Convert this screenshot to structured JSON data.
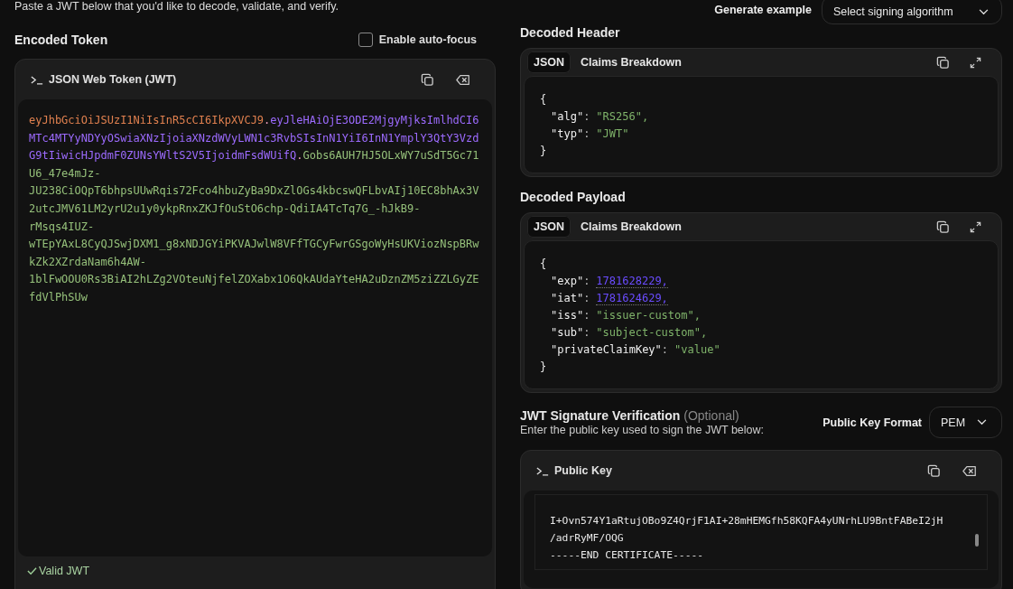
{
  "intro": "Paste a JWT below that you'd like to decode, validate, and verify.",
  "generate": {
    "label": "Generate example",
    "select_placeholder": "Select signing algorithm"
  },
  "encoded": {
    "title": "Encoded Token",
    "autofocus": {
      "label": "Enable auto-focus",
      "checked": false
    },
    "editor_title": "JSON Web Token (JWT)",
    "segments": [
      {
        "text": "eyJhbGciOiJSUzI1NiIsInR5cCI6IkpXVCJ9",
        "color": "#e0804f"
      },
      {
        "text": ".",
        "kind": "dot"
      },
      {
        "text": "eyJleHAiOjE3ODE2MjgyMjksImlhdCI6MTc4MTYyNDYyOSwiaXNzIjoiaXNzdWVyLWN1c3RvbSIsInN1YiI6InN1YmplY3QtY3VzdG9tIiwicHJpdmF0ZUNsYWltS2V5IjoidmFsdWUifQ",
        "color": "#9d6bff"
      },
      {
        "text": ".",
        "kind": "dot"
      },
      {
        "text": "Gobs6AUH7HJ5OLxWY7uSdT5Gc71U6_47e4mJz-JU238CiOQpT6bhpsUUwRqis72Fco4hbuZyBa9DxZlOGs4kbcswQFLbvAIj10EC8bhAx3V2utcJMV61LM2yrU2u1y0ykpRnxZKJfOuStO6chp-QdiIA4TcTq7G_-hJkB9-rMsqs4IUZ-wTEpYAxL8CyQJSwjDXM1_g8xNDJGYiPKVAJwlW8VFfTGCyFwrGSgoWyHsUKViozNspBRwkZk2XZrdaNam6h4AW-1blFwOOU0Rs3BiAI2hLZg2VOteuNjfelZOXabx1O6QkAUdaYteHA2uDznZM5ziZZLGyZEfdVlPhSUw",
        "color": "#95c07a"
      }
    ],
    "status": "Valid JWT"
  },
  "panels": [
    {
      "title": "Decoded Header",
      "tabs": [
        {
          "label": "JSON",
          "selected": true
        },
        {
          "label": "Claims Breakdown",
          "selected": false
        }
      ],
      "open": "{",
      "close": "}",
      "lines": [
        {
          "key": "\"alg\"",
          "sep": ":",
          "value": "\"RS256\",",
          "kind": "string"
        },
        {
          "key": "\"typ\"",
          "sep": ":",
          "value": "\"JWT\"",
          "kind": "string"
        }
      ]
    },
    {
      "title": "Decoded Payload",
      "tabs": [
        {
          "label": "JSON",
          "selected": true
        },
        {
          "label": "Claims Breakdown",
          "selected": false
        }
      ],
      "open": "{",
      "close": "}",
      "lines": [
        {
          "key": "\"exp\"",
          "sep": ":",
          "value": "1781628229,",
          "kind": "number"
        },
        {
          "key": "\"iat\"",
          "sep": ":",
          "value": "1781624629,",
          "kind": "number"
        },
        {
          "key": "\"iss\"",
          "sep": ":",
          "value": "\"issuer-custom\",",
          "kind": "string"
        },
        {
          "key": "\"sub\"",
          "sep": ":",
          "value": "\"subject-custom\",",
          "kind": "string"
        },
        {
          "key": "\"privateClaimKey\"",
          "sep": ":",
          "value": "\"value\"",
          "kind": "string"
        }
      ]
    }
  ],
  "verification": {
    "title": "JWT Signature Verification",
    "optional": "(Optional)",
    "subtitle": "Enter the public key used to sign the JWT below:",
    "format_label": "Public Key Format",
    "format_value": "PEM",
    "editor_title": "Public Key",
    "key_lines": [
      "I+Ovn574Y1aRtujOBo9Z4QrjF1AI+28mHEMGfh58KQFA4yUNrhLU9BntFABeI2jH",
      "/adrRyMF/OQG",
      "-----END CERTIFICATE-----"
    ]
  }
}
